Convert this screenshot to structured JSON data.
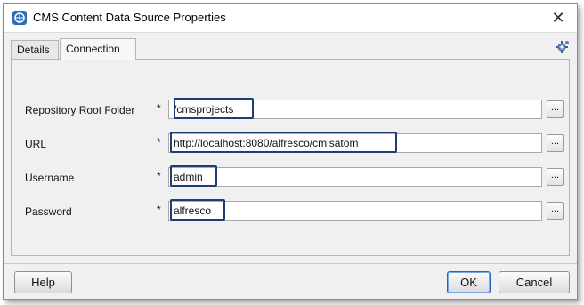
{
  "window": {
    "title": "CMS Content Data Source Properties",
    "close_glyph": "✕",
    "app_icon": "cms-datasource-icon"
  },
  "tabs": [
    {
      "label": "Details",
      "active": false
    },
    {
      "label": "Connection",
      "active": true
    }
  ],
  "tab_tool_icon": "settings-gear-icon",
  "form": {
    "required_marker": "*",
    "browse_label": "...",
    "fields": [
      {
        "label": "Repository Root Folder",
        "value": "/cmsprojects"
      },
      {
        "label": "URL",
        "value": "http://localhost:8080/alfresco/cmisatom"
      },
      {
        "label": "Username",
        "value": "admin"
      },
      {
        "label": "Password",
        "value": "alfresco"
      }
    ]
  },
  "buttons": {
    "help": "Help",
    "ok": "OK",
    "cancel": "Cancel"
  },
  "colors": {
    "highlight_border": "#1f3c73",
    "ok_border": "#2b62b5",
    "window_bg": "#f0f0f0"
  }
}
